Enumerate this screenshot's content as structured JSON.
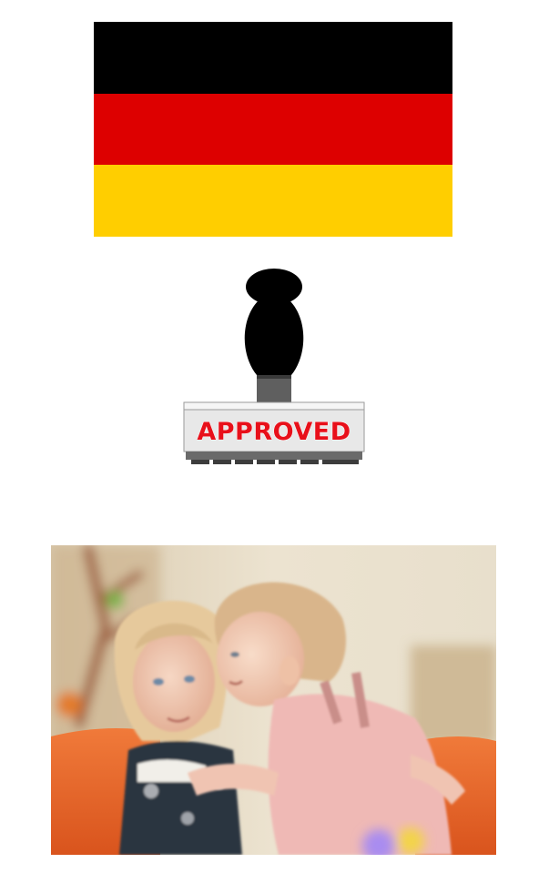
{
  "flag": {
    "country": "Germany",
    "bands": [
      {
        "name": "black",
        "color": "#000000"
      },
      {
        "name": "red",
        "color": "#DD0000"
      },
      {
        "name": "gold",
        "color": "#FFCE00"
      }
    ]
  },
  "stamp": {
    "label": "APPROVED",
    "ink_color": "#E8101A",
    "handle_color": "#000000",
    "neck_color": "#5F5F5F",
    "base_color": "#E8E8E8"
  },
  "photo": {
    "wall_color": "#E9DFCB",
    "sofa_color": "#EE6A2A",
    "left_child_hair": "#E3C79A",
    "right_child_top": "#EFB9B5"
  }
}
